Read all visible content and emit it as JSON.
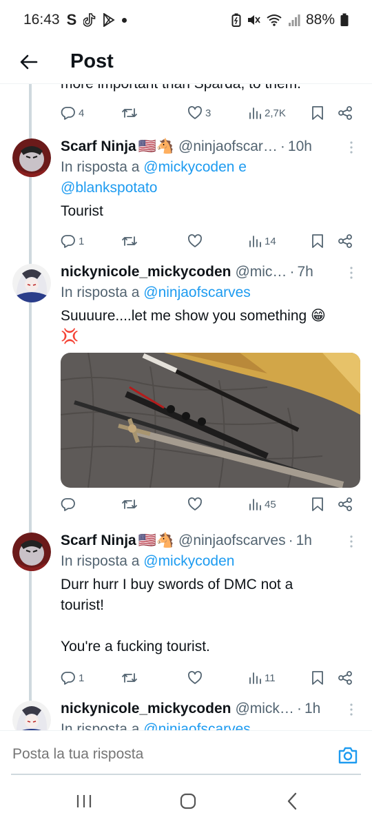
{
  "status_bar": {
    "time": "16:43",
    "battery": "88%",
    "icons": [
      "s-app-icon",
      "tiktok-icon",
      "play-store-icon",
      "dot-icon",
      "battery-saver-icon",
      "mute-icon",
      "wifi-icon",
      "signal-icon",
      "battery-icon"
    ]
  },
  "header": {
    "title": "Post",
    "back_icon": "arrow-left-icon"
  },
  "thread": {
    "partial_text": "more important than Sparda, to them.",
    "partial_actions": {
      "replies": "4",
      "reposts": "",
      "likes": "3",
      "views": "2,7K"
    },
    "tweets": [
      {
        "name": "Scarf Ninja",
        "emoji": "🇺🇸🐴",
        "handle": "@ninjaofscar…",
        "time": "10h",
        "reply_prefix": "In risposta a",
        "mentions": [
          "@mickycoden",
          "@blankspotato"
        ],
        "mention_joiner": "e",
        "text": "Tourist",
        "actions": {
          "replies": "1",
          "reposts": "",
          "likes": "",
          "views": "14"
        }
      },
      {
        "name": "nickynicole_mickycoden",
        "emoji": "",
        "handle": "@mic…",
        "time": "7h",
        "reply_prefix": "In risposta a",
        "mentions": [
          "@ninjaofscarves"
        ],
        "text": "Suuuure....let me show you something 😁",
        "text_line2": "💢",
        "media": "photo of swords on a quilted blanket",
        "actions": {
          "replies": "",
          "reposts": "",
          "likes": "",
          "views": "45"
        }
      },
      {
        "name": "Scarf Ninja",
        "emoji": "🇺🇸🐴",
        "handle": "@ninjaofscarves",
        "time": "1h",
        "reply_prefix": "In risposta a",
        "mentions": [
          "@mickycoden"
        ],
        "text_line1": "Durr hurr I buy swords of DMC not a",
        "text_line2": "tourist!",
        "text_line3": "You're a fucking tourist.",
        "actions": {
          "replies": "1",
          "reposts": "",
          "likes": "",
          "views": "11"
        }
      },
      {
        "name": "nickynicole_mickycoden",
        "emoji": "",
        "handle": "@mick…",
        "time": "1h",
        "reply_prefix": "In risposta a",
        "mentions": [
          "@ninjaofscarves"
        ]
      }
    ]
  },
  "reply_bar": {
    "placeholder": "Posta la tua risposta",
    "camera_icon": "camera-icon"
  },
  "nav_bar": {
    "icons": [
      "recents-icon",
      "home-icon",
      "back-icon"
    ]
  },
  "colors": {
    "accent": "#1d9bf0",
    "secondary_text": "#536471",
    "primary_text": "#0f1419",
    "thread_line": "#cfd9de"
  }
}
